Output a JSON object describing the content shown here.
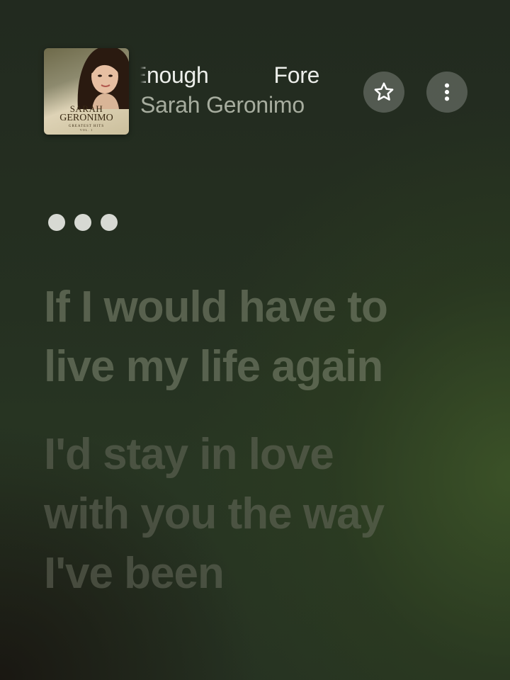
{
  "now_playing": {
    "title_scroll_a": "Enough",
    "title_scroll_b": "Fore",
    "artist": "Sarah Geronimo",
    "album_art": {
      "text_line1": "SARAH",
      "text_line2": "GERONIMO",
      "text_sub": "GREATEST HITS",
      "text_vol": "VOL. 1"
    }
  },
  "controls": {
    "favorite_icon": "star-icon",
    "more_icon": "more-vertical-icon"
  },
  "lyrics": {
    "verses": [
      {
        "lines": [
          "If I would have to",
          "live my life again"
        ]
      },
      {
        "lines": [
          "I'd stay in love",
          "with you the way",
          "I've been"
        ]
      }
    ]
  },
  "colors": {
    "background": "#222a1f",
    "accent_green": "#3e5628",
    "title_text": "#eceeea",
    "artist_text": "#a7ad9f",
    "lyric_dim": "#78806a"
  }
}
